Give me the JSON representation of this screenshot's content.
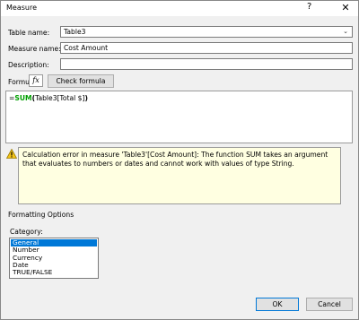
{
  "window": {
    "title": "Measure",
    "help_glyph": "?",
    "close_glyph": "✕"
  },
  "form": {
    "table_name_label": "Table name:",
    "table_name_value": "Table3",
    "measure_name_label": "Measure name:",
    "measure_name_value": "Cost Amount",
    "description_label": "Description:",
    "description_value": "",
    "formula_label": "Formula:",
    "fx_glyph": "fx",
    "check_formula_label": "Check formula"
  },
  "formula": {
    "prefix": "=",
    "function": "SUM",
    "open_paren": "(",
    "argument": "Table3[Total $]",
    "close_paren": ")"
  },
  "error": {
    "icon": "warning-icon",
    "message": "Calculation error in measure 'Table3'[Cost Amount]: The function SUM takes an argument that evaluates to numbers or dates and cannot work with values of type String."
  },
  "formatting": {
    "section_title": "Formatting Options",
    "category_label": "Category:",
    "categories": [
      "General",
      "Number",
      "Currency",
      "Date",
      "TRUE/FALSE"
    ],
    "selected": "General"
  },
  "buttons": {
    "ok": "OK",
    "cancel": "Cancel"
  },
  "colors": {
    "selection": "#0078d7",
    "error_background": "#ffffe1",
    "function_green": "#00a000"
  }
}
